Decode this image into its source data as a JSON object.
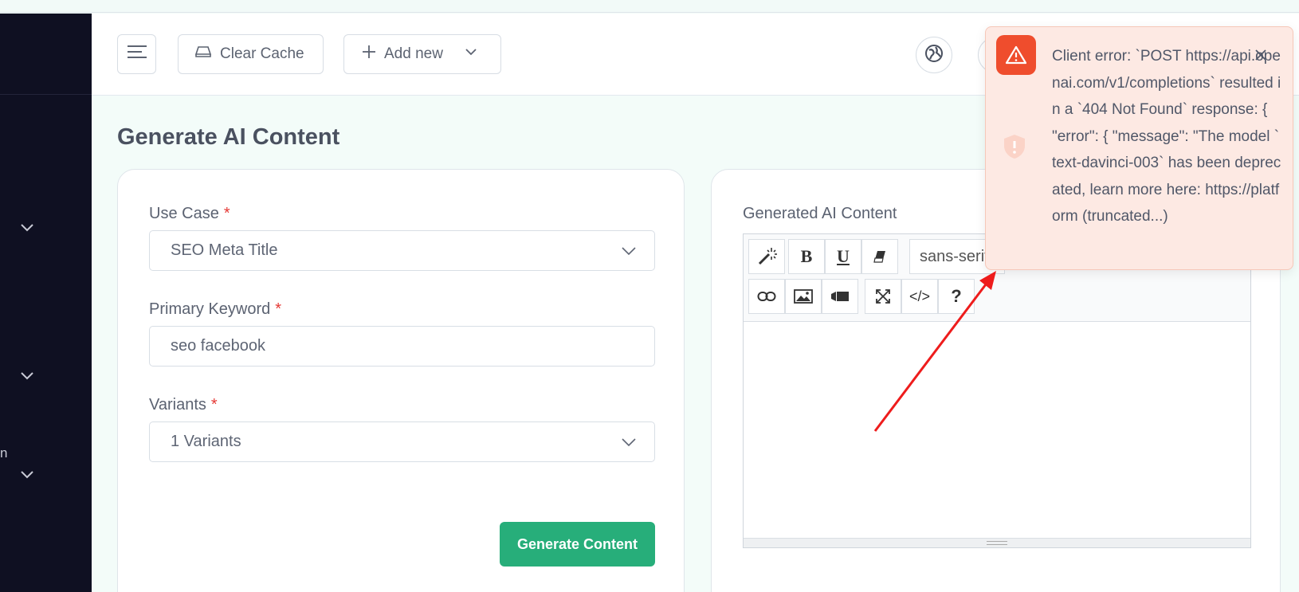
{
  "header": {
    "clear_cache_label": "Clear Cache",
    "add_new_label": "Add new"
  },
  "sidebar": {
    "fragment_text": "n"
  },
  "page": {
    "title": "Generate AI Content"
  },
  "form": {
    "use_case": {
      "label": "Use Case",
      "required_mark": "*",
      "value": "SEO Meta Title"
    },
    "primary_keyword": {
      "label": "Primary Keyword",
      "required_mark": "*",
      "value": "seo facebook"
    },
    "variants": {
      "label": "Variants",
      "required_mark": "*",
      "value": "1 Variants"
    },
    "submit_label": "Generate Content"
  },
  "editor": {
    "label": "Generated AI Content",
    "font_family_value": "sans-serif",
    "bold_glyph": "B",
    "underline_glyph": "U",
    "help_glyph": "?",
    "code_glyph": "</>"
  },
  "toast": {
    "message": "Client error: `POST https://api.openai.com/v1/completions` resulted in a `404 Not Found` response: { \"error\": { \"message\": \"The model `text-davinci-003` has been deprecated, learn more here: https://platform (truncated...)"
  },
  "colors": {
    "sidebar_bg": "#0f1022",
    "primary_green": "#27ae7a",
    "error_accent": "#ef4d2d",
    "toast_bg": "#fde9e3",
    "required": "#e53935",
    "annotation_arrow": "#ee1c1c"
  }
}
